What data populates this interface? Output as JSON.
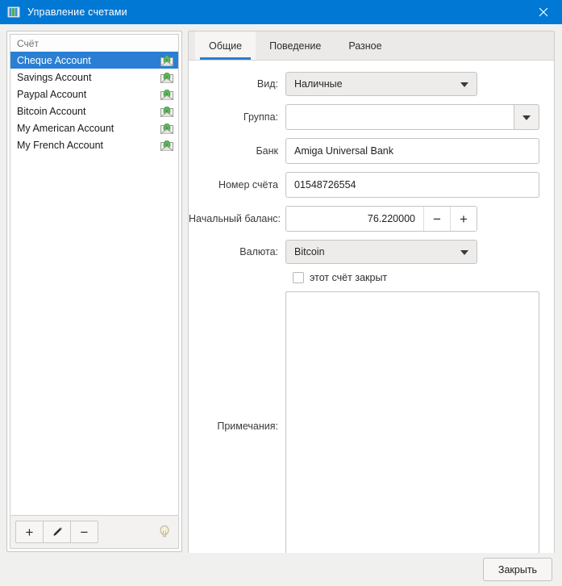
{
  "window": {
    "title": "Управление счетами",
    "icon": "accounts-book-icon",
    "close_icon": "close-icon",
    "accent_color": "#0078d4",
    "selection_color": "#2a7fd4"
  },
  "sidebar": {
    "header": "Счёт",
    "items": [
      {
        "label": "Cheque Account",
        "icon": "envelope-money-icon",
        "selected": true
      },
      {
        "label": "Savings Account",
        "icon": "envelope-money-icon",
        "selected": false
      },
      {
        "label": "Paypal Account",
        "icon": "envelope-money-icon",
        "selected": false
      },
      {
        "label": "Bitcoin Account",
        "icon": "envelope-money-icon",
        "selected": false
      },
      {
        "label": "My American Account",
        "icon": "envelope-money-icon",
        "selected": false
      },
      {
        "label": "My French Account",
        "icon": "envelope-money-icon",
        "selected": false
      }
    ],
    "toolbar": {
      "add_label": "+",
      "edit_label": "edit-pencil-icon",
      "remove_label": "−",
      "hint_icon": "lightbulb-icon"
    }
  },
  "tabs": [
    {
      "label": "Общие",
      "active": true
    },
    {
      "label": "Поведение",
      "active": false
    },
    {
      "label": "Разное",
      "active": false
    }
  ],
  "form": {
    "type": {
      "label": "Вид:",
      "value": "Наличные"
    },
    "group": {
      "label": "Группа:",
      "value": "",
      "placeholder": ""
    },
    "bank": {
      "label": "Банк",
      "value": "Amiga Universal Bank",
      "placeholder": ""
    },
    "account_number": {
      "label": "Номер счёта",
      "value": "01548726554",
      "placeholder": ""
    },
    "initial_balance": {
      "label": "Начальный баланс:",
      "value": "76.220000",
      "decrement_label": "−",
      "increment_label": "+"
    },
    "currency": {
      "label": "Валюта:",
      "value": "Bitcoin"
    },
    "closed_checkbox": {
      "label": "этот счёт закрыт",
      "checked": false
    },
    "notes": {
      "label": "Примечания:",
      "value": "",
      "placeholder": ""
    }
  },
  "footer": {
    "close_label": "Закрыть"
  }
}
